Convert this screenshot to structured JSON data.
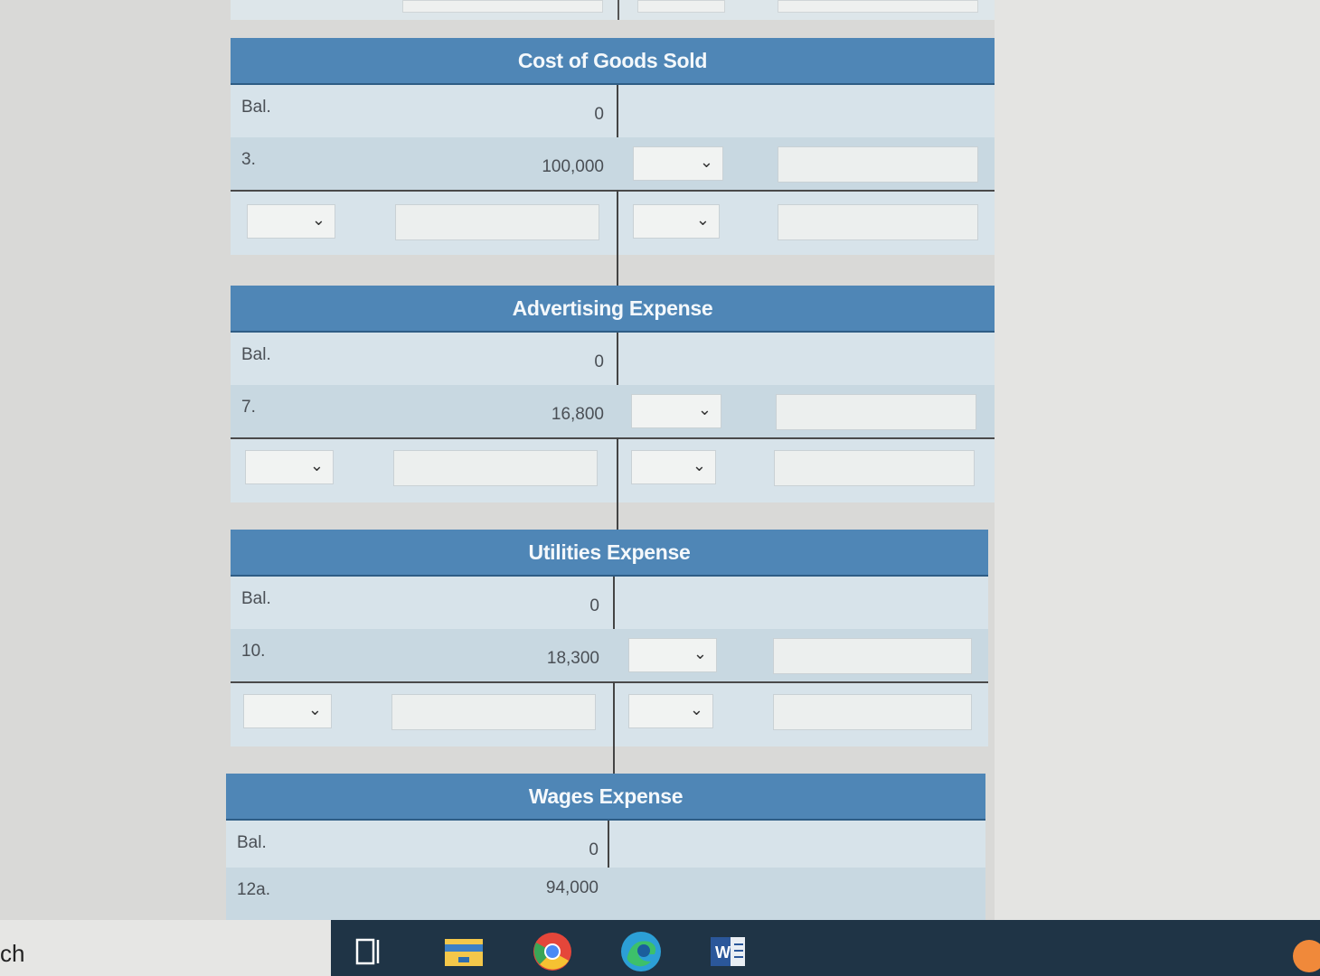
{
  "accounts": [
    {
      "title": "Cost of Goods Sold",
      "rows": [
        {
          "label": "Bal.",
          "amount": "0"
        },
        {
          "label": "3.",
          "amount": "100,000"
        }
      ]
    },
    {
      "title": "Advertising Expense",
      "rows": [
        {
          "label": "Bal.",
          "amount": "0"
        },
        {
          "label": "7.",
          "amount": "16,800"
        }
      ]
    },
    {
      "title": "Utilities Expense",
      "rows": [
        {
          "label": "Bal.",
          "amount": "0"
        },
        {
          "label": "10.",
          "amount": "18,300"
        }
      ]
    },
    {
      "title": "Wages Expense",
      "rows": [
        {
          "label": "Bal.",
          "amount": "0"
        },
        {
          "label": "12a.",
          "amount": "94,000"
        }
      ]
    }
  ],
  "select_placeholder": "",
  "taskbar": {
    "search_text": "ch"
  }
}
